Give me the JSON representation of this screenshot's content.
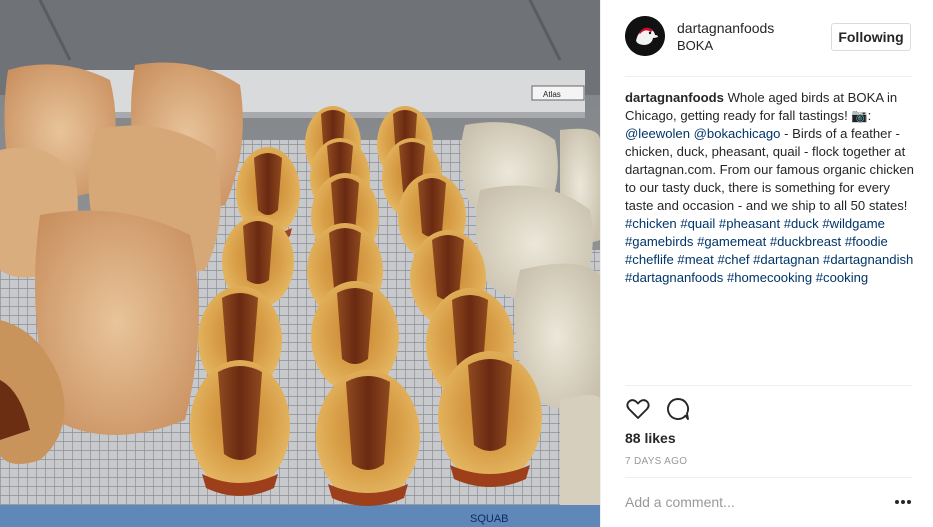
{
  "account": {
    "username": "dartagnanfoods",
    "location": "BOKA",
    "follow_label": "Following",
    "avatar_icon": "duck-silhouette-logo"
  },
  "caption": {
    "username": "dartagnanfoods",
    "text_1": " Whole aged birds at BOKA in Chicago, getting ready for fall tastings! ",
    "camera_icon": "camera-icon",
    "text_2": ": ",
    "mention_1": "@leewolen",
    "mention_2": "@bokachicago",
    "text_3": " - Birds of a feather - chicken, duck, pheasant, quail - flock together at dartagnan.com. From our famous organic chicken to our tasty duck, there is something for every taste and occasion - and we ship to all 50 states! ",
    "hashtags": [
      "#chicken",
      "#quail",
      "#pheasant",
      "#duck",
      "#wildgame",
      "#gamebirds",
      "#gamemeat",
      "#duckbreast",
      "#foodie",
      "#cheflife",
      "#meat",
      "#chef",
      "#dartagnan",
      "#dartagnandish",
      "#dartagnanfoods",
      "#homecooking",
      "#cooking"
    ]
  },
  "actions": {
    "like_icon": "heart-icon",
    "comment_icon": "speech-bubble-icon"
  },
  "likes": "88 likes",
  "timestamp": "7 DAYS AGO",
  "comment_placeholder": "Add a comment...",
  "more_icon": "more-options-icon",
  "photo": {
    "description_only": false,
    "tray_label": "SQUAB",
    "scale_brand": "Atlas"
  },
  "colors": {
    "link": "#003569",
    "text": "#262626",
    "muted": "#999999",
    "border": "#efefef"
  }
}
